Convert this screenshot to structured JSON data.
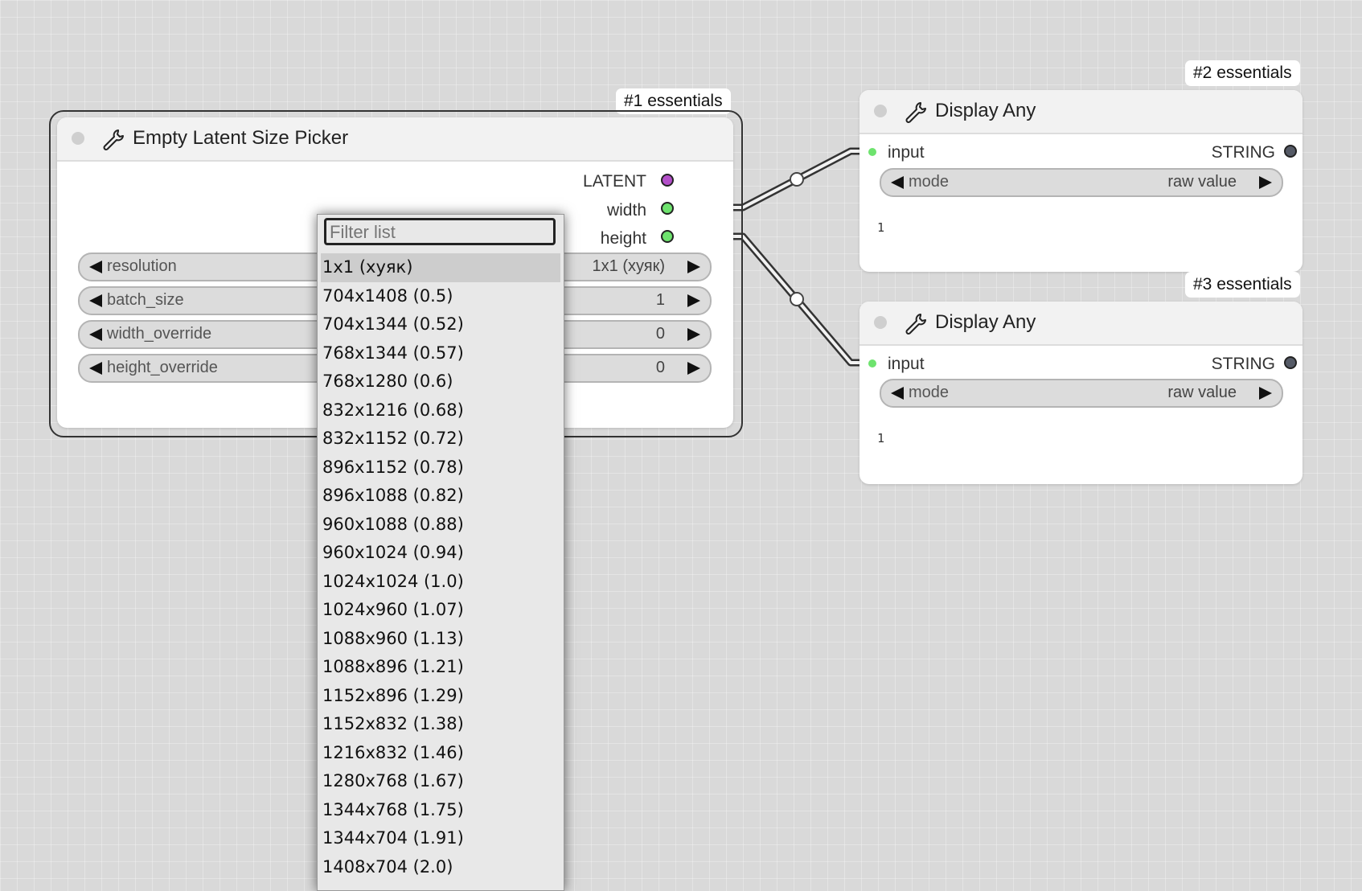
{
  "node1": {
    "badge": "#1 essentials",
    "title": "Empty Latent Size Picker",
    "outputs": [
      "LATENT",
      "width",
      "height"
    ],
    "widgets": [
      {
        "label": "resolution",
        "value": "1x1 (хуяк)"
      },
      {
        "label": "batch_size",
        "value": "1"
      },
      {
        "label": "width_override",
        "value": "0"
      },
      {
        "label": "height_override",
        "value": "0"
      }
    ]
  },
  "node2": {
    "badge": "#2 essentials",
    "title": "Display Any",
    "input_label": "input",
    "output_label": "STRING",
    "widget": {
      "label": "mode",
      "value": "raw value"
    },
    "output_text": "1"
  },
  "node3": {
    "badge": "#3 essentials",
    "title": "Display Any",
    "input_label": "input",
    "output_label": "STRING",
    "widget": {
      "label": "mode",
      "value": "raw value"
    },
    "output_text": "1"
  },
  "dropdown": {
    "filter_placeholder": "Filter list",
    "items": [
      "1x1 (хуяк)",
      "704x1408 (0.5)",
      "704x1344 (0.52)",
      "768x1344 (0.57)",
      "768x1280 (0.6)",
      "832x1216 (0.68)",
      "832x1152 (0.72)",
      "896x1152 (0.78)",
      "896x1088 (0.82)",
      "960x1088 (0.88)",
      "960x1024 (0.94)",
      "1024x1024 (1.0)",
      "1024x960 (1.07)",
      "1088x960 (1.13)",
      "1088x896 (1.21)",
      "1152x896 (1.29)",
      "1152x832 (1.38)",
      "1216x832 (1.46)",
      "1280x768 (1.67)",
      "1344x768 (1.75)",
      "1344x704 (1.91)",
      "1408x704 (2.0)"
    ],
    "selected_index": 0
  },
  "colors": {
    "latent_slot": "#b34fc9",
    "int_slot": "#6ee36e",
    "string_slot": "#555a66",
    "link": "#6b6b6b"
  }
}
